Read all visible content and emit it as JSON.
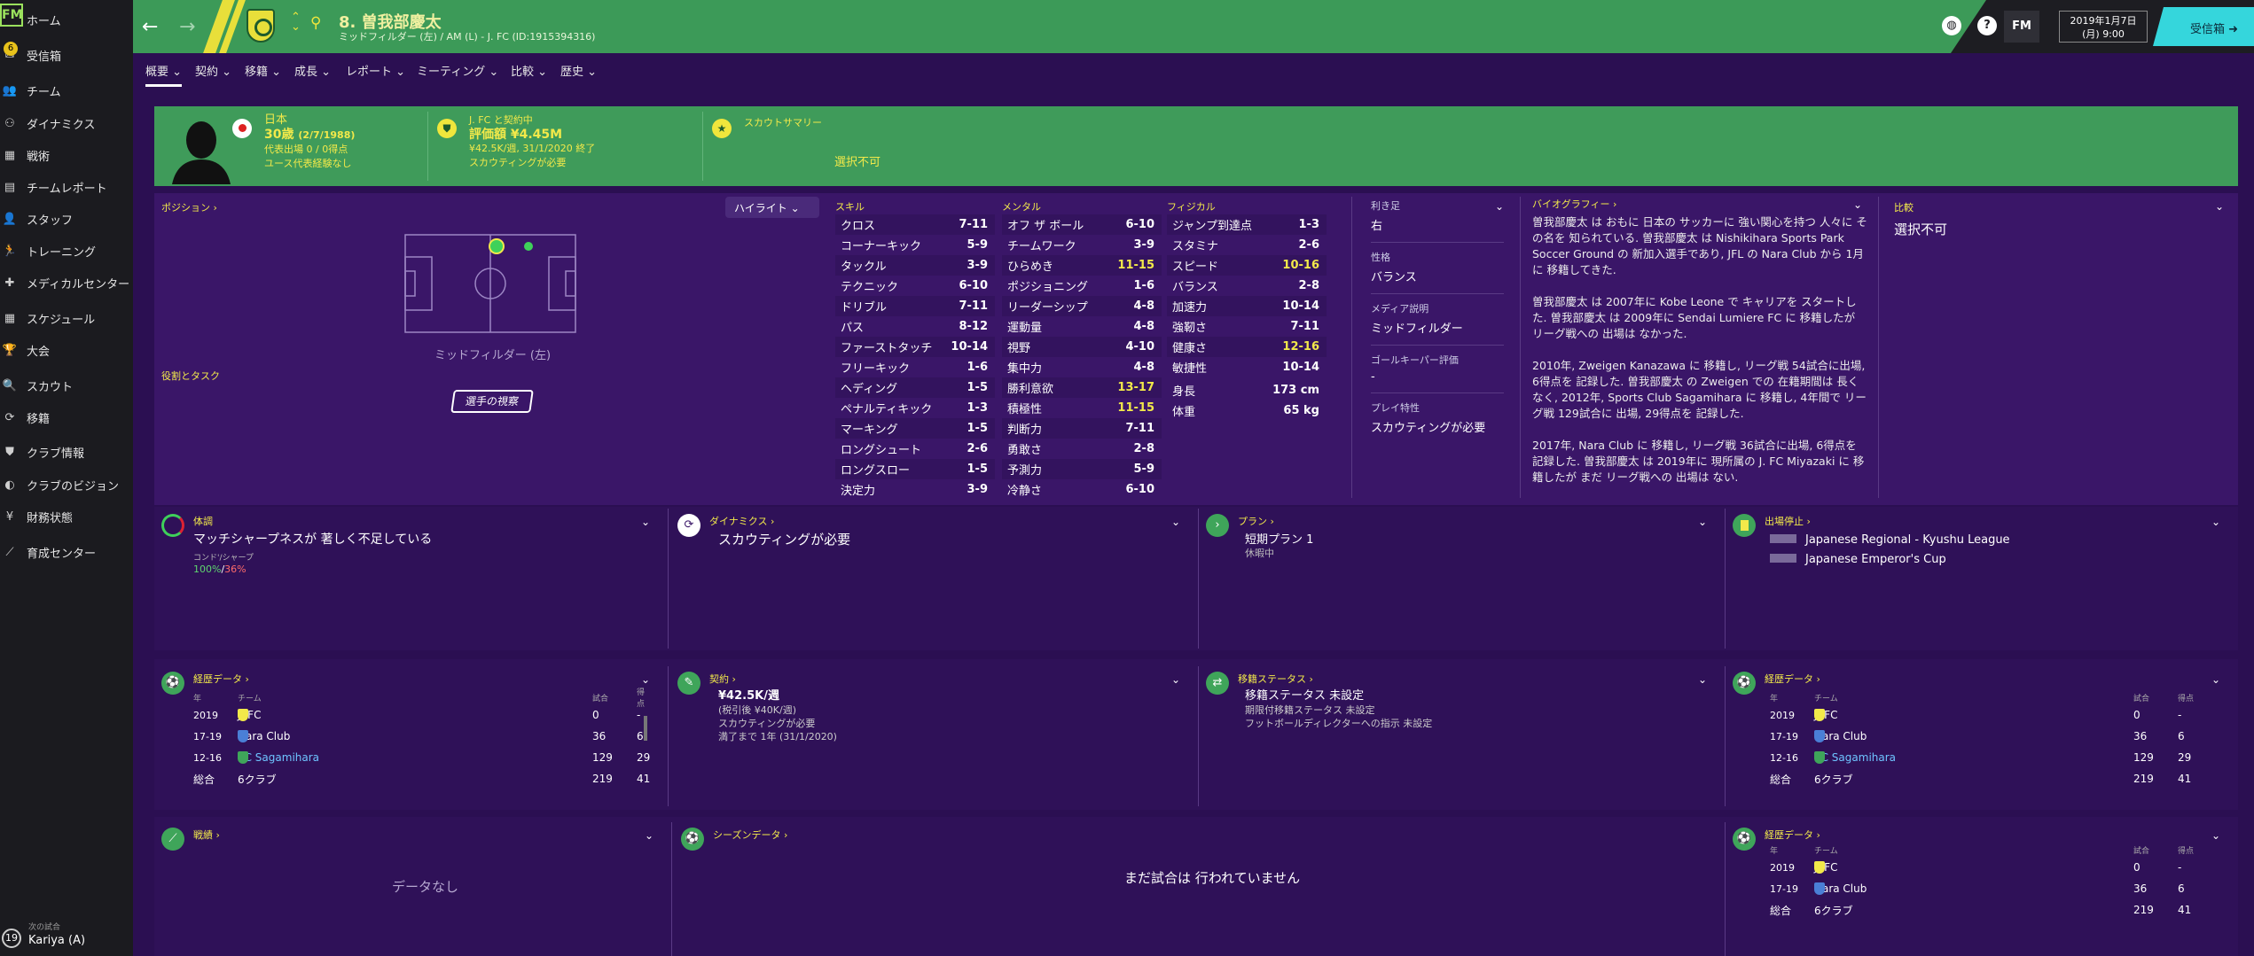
{
  "sidebar": {
    "logo": "FM",
    "badge": "6",
    "items": [
      {
        "label": "ホーム",
        "icon": "home-icon"
      },
      {
        "label": "受信箱",
        "icon": "inbox-icon"
      },
      {
        "label": "チーム",
        "icon": "team-icon"
      },
      {
        "label": "ダイナミクス",
        "icon": "dynamics-icon"
      },
      {
        "label": "戦術",
        "icon": "tactics-icon"
      },
      {
        "label": "チームレポート",
        "icon": "report-icon"
      },
      {
        "label": "スタッフ",
        "icon": "staff-icon"
      },
      {
        "label": "トレーニング",
        "icon": "training-icon"
      },
      {
        "label": "メディカルセンター",
        "icon": "medical-icon"
      },
      {
        "label": "スケジュール",
        "icon": "calendar-icon"
      },
      {
        "label": "大会",
        "icon": "trophy-icon"
      },
      {
        "label": "スカウト",
        "icon": "scout-icon"
      },
      {
        "label": "移籍",
        "icon": "transfer-icon"
      },
      {
        "label": "クラブ情報",
        "icon": "club-info-icon"
      },
      {
        "label": "クラブのビジョン",
        "icon": "vision-icon"
      },
      {
        "label": "財務状態",
        "icon": "finance-icon"
      },
      {
        "label": "育成センター",
        "icon": "youth-icon"
      }
    ],
    "next_match_label": "次の試合",
    "next_match": "Kariya (A)",
    "next_match_day": "19"
  },
  "topbar": {
    "player_name": "8. 曽我部慶太",
    "player_sub": "ミッドフィルダー (左) / AM (L) - J. FC (ID:1915394316)",
    "fm": "FM",
    "date_line1": "2019年1月7日",
    "date_line2": "(月) 9:00",
    "inbox": "受信箱"
  },
  "tabs": [
    "概要",
    "契約",
    "移籍",
    "成長",
    "レポート",
    "ミーティング",
    "比較",
    "歴史"
  ],
  "header": {
    "nation": "日本",
    "age": "30歳",
    "dob": "(2/7/1988)",
    "caps": "代表出場 0 / 0得点",
    "youth": "ユース代表経験なし",
    "contract_title": "J. FC と契約中",
    "value": "評価額 ¥4.45M",
    "wage": "¥42.5K/週, 31/1/2020 終了",
    "scouting": "スカウティングが必要",
    "scout_summary_title": "スカウトサマリー",
    "scout_summary": "選択不可"
  },
  "position": {
    "title": "ポジション",
    "highlight": "ハイライト",
    "pos_label": "ミッドフィルダー (左)",
    "roles_title": "役割とタスク",
    "scout_button": "選手の視察"
  },
  "skills": {
    "title": "スキル",
    "rows": [
      [
        "クロス",
        "7-11"
      ],
      [
        "コーナーキック",
        "5-9"
      ],
      [
        "タックル",
        "3-9"
      ],
      [
        "テクニック",
        "6-10"
      ],
      [
        "ドリブル",
        "7-11"
      ],
      [
        "パス",
        "8-12"
      ],
      [
        "ファーストタッチ",
        "10-14"
      ],
      [
        "フリーキック",
        "1-6"
      ],
      [
        "ヘディング",
        "1-5"
      ],
      [
        "ペナルティキック",
        "1-3"
      ],
      [
        "マーキング",
        "1-5"
      ],
      [
        "ロングシュート",
        "2-6"
      ],
      [
        "ロングスロー",
        "1-5"
      ],
      [
        "決定力",
        "3-9"
      ]
    ]
  },
  "mental": {
    "title": "メンタル",
    "rows": [
      [
        "オフ ザ ボール",
        "6-10"
      ],
      [
        "チームワーク",
        "3-9"
      ],
      [
        "ひらめき",
        "11-15"
      ],
      [
        "ポジショニング",
        "1-6"
      ],
      [
        "リーダーシップ",
        "4-8"
      ],
      [
        "運動量",
        "4-8"
      ],
      [
        "視野",
        "4-10"
      ],
      [
        "集中力",
        "4-8"
      ],
      [
        "勝利意欲",
        "13-17"
      ],
      [
        "積極性",
        "11-15"
      ],
      [
        "判断力",
        "7-11"
      ],
      [
        "勇敢さ",
        "2-8"
      ],
      [
        "予測力",
        "5-9"
      ],
      [
        "冷静さ",
        "6-10"
      ]
    ]
  },
  "physical": {
    "title": "フィジカル",
    "rows": [
      [
        "ジャンプ到達点",
        "1-3"
      ],
      [
        "スタミナ",
        "2-6"
      ],
      [
        "スピード",
        "10-16"
      ],
      [
        "バランス",
        "2-8"
      ],
      [
        "加速力",
        "10-14"
      ],
      [
        "強靭さ",
        "7-11"
      ],
      [
        "健康さ",
        "12-16"
      ],
      [
        "敏捷性",
        "10-14"
      ]
    ],
    "height_label": "身長",
    "height": "173 cm",
    "weight_label": "体重",
    "weight": "65 kg"
  },
  "details": {
    "foot_label": "利き足",
    "foot": "右",
    "personality_label": "性格",
    "personality": "バランス",
    "media_label": "メディア説明",
    "media": "ミッドフィルダー",
    "gk_label": "ゴールキーパー評価",
    "gk": "-",
    "traits_label": "プレイ特性",
    "traits": "スカウティングが必要"
  },
  "bio": {
    "title": "バイオグラフィー",
    "p1": "曽我部慶太 は おもに 日本の サッカーに 強い関心を持つ 人々に その名を 知られている. 曽我部慶太 は Nishikihara Sports Park Soccer Ground の 新加入選手であり, JFL の Nara Club から 1月に 移籍してきた.",
    "p2": "曽我部慶太 は 2007年に Kobe Leone で キャリアを スタートした. 曽我部慶太 は 2009年に Sendai Lumiere FC に 移籍したが リーグ戦への 出場は なかった.",
    "p3": "2010年, Zweigen Kanazawa に 移籍し, リーグ戦 54試合に出場, 6得点を 記録した. 曽我部慶太 の Zweigen での 在籍期間は 長くなく, 2012年, Sports Club Sagamihara に 移籍し, 4年間で リーグ戦 129試合に 出場, 29得点を 記録した.",
    "p4": "2017年, Nara Club に 移籍し, リーグ戦 36試合に出場, 6得点を 記録した. 曽我部慶太 は 2019年に 現所属の J. FC Miyazaki に 移籍したが まだ リーグ戦への 出場は ない."
  },
  "compare": {
    "title": "比較",
    "value": "選択不可"
  },
  "condition": {
    "title": "体調",
    "text": "マッチシャープネスが 著しく不足している",
    "sub": "コンド'/シャープ",
    "cond": "100%",
    "sharp": "36%"
  },
  "dynamics": {
    "title": "ダイナミクス",
    "text": "スカウティングが必要"
  },
  "plan": {
    "title": "プラン",
    "text": "短期プラン 1",
    "sub": "休暇中"
  },
  "bans": {
    "title": "出場停止",
    "rows": [
      "Japanese Regional - Kyushu League",
      "Japanese Emperor's Cup"
    ]
  },
  "career": {
    "title": "経歴データ",
    "h_year": "年",
    "h_team": "チーム",
    "h_apps": "試合",
    "h_goals": "得点",
    "rows": [
      [
        "2019",
        "J. FC",
        "0",
        "-"
      ],
      [
        "17-19",
        "Nara Club",
        "36",
        "6"
      ],
      [
        "12-16",
        "SC Sagamihara",
        "129",
        "29"
      ]
    ],
    "total_label": "総合",
    "total_clubs": "6クラブ",
    "total_apps": "219",
    "total_goals": "41"
  },
  "contract": {
    "title": "契約",
    "wage": "¥42.5K/週",
    "pre_tax": "(税引後 ¥40K/週)",
    "scouting": "スカウティングが必要",
    "expiry": "満了まで 1年 (31/1/2020)"
  },
  "transfer": {
    "title": "移籍ステータス",
    "status": "移籍ステータス 未設定",
    "line1": "期限付移籍ステータス 未設定",
    "line2": "フットボールディレクターへの指示 未設定"
  },
  "record": {
    "title": "戦績",
    "empty": "データなし"
  },
  "season": {
    "title": "シーズンデータ",
    "empty": "まだ試合は 行われていません"
  },
  "career3": {
    "rows": [
      [
        "2019",
        "J. FC",
        "0",
        "-"
      ],
      [
        "17-19",
        "Nara Club",
        "36",
        "6"
      ]
    ],
    "total_label": "総合",
    "total_clubs": "6クラブ",
    "total_apps": "219",
    "total_goals": "41"
  }
}
